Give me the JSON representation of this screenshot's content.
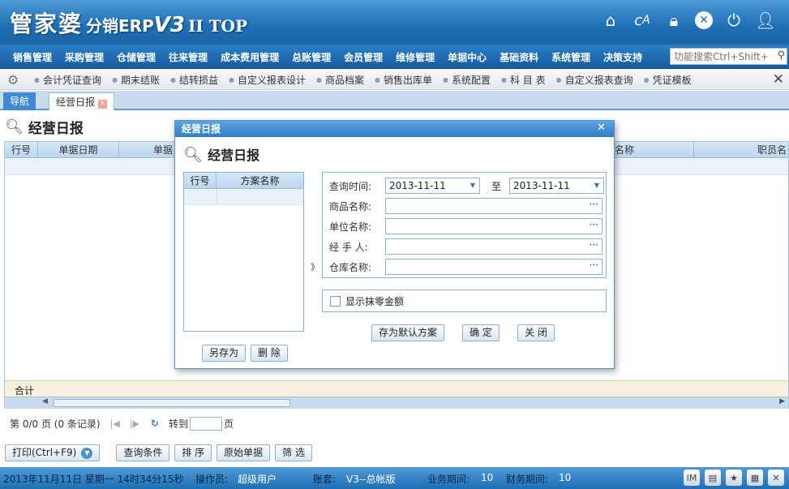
{
  "header": {
    "brand_main": "管家婆",
    "brand_sub": "分销ERP",
    "brand_ver": "V3",
    "brand_edition": "II TOP",
    "icons": [
      "home-icon",
      "font-icon",
      "lock-icon",
      "close-icon",
      "power-icon",
      "user-icon"
    ]
  },
  "menu": {
    "items": [
      "销售管理",
      "采购管理",
      "仓储管理",
      "往来管理",
      "成本费用管理",
      "总账管理",
      "会员管理",
      "维修管理",
      "单据中心",
      "基础资料",
      "系统管理",
      "决策支持"
    ],
    "search_placeholder": "功能搜索Ctrl+Shift+F"
  },
  "quicklinks": [
    "会计凭证查询",
    "期末结账",
    "结转损益",
    "自定义报表设计",
    "商品档案",
    "销售出库单",
    "系统配置",
    "科 目 表",
    "自定义报表查询",
    "凭证模板"
  ],
  "tabs": {
    "nav": "导航",
    "active": "经营日报"
  },
  "page": {
    "title": "经营日报",
    "columns": [
      "行号",
      "单据日期",
      "单据",
      "名称",
      "职员名"
    ],
    "footer_label": "合计"
  },
  "pager": {
    "info": "第 0/0 页 (0 条记录)",
    "goto": "转到",
    "page_unit": "页"
  },
  "bottom_buttons": [
    "打印(Ctrl+F9)",
    "查询条件",
    "排 序",
    "原始单据",
    "筛 选"
  ],
  "status": {
    "datetime": "2013年11月11日 星期一 14时34分15秒",
    "operator_label": "操作员:",
    "operator": "超级用户",
    "account_label": "账套:",
    "account": "V3--总帐版",
    "biz_period_label": "业务期间:",
    "biz_period": "10",
    "fin_period_label": "财务期间:",
    "fin_period": "10"
  },
  "dialog": {
    "title": "经营日报",
    "heading": "经营日报",
    "scheme_cols": [
      "行号",
      "方案名称"
    ],
    "save_as": "另存为",
    "delete": "删 除",
    "expander": "》",
    "date_label": "查询时间:",
    "date_from": "2013-11-11",
    "to_label": "至",
    "date_to": "2013-11-11",
    "product_label": "商品名称:",
    "unit_label": "单位名称:",
    "handler_label": "经 手 人:",
    "warehouse_label": "仓库名称:",
    "show_rounding_label": "显示抹零金额",
    "save_default": "存为默认方案",
    "ok": "确 定",
    "close": "关 闭"
  }
}
